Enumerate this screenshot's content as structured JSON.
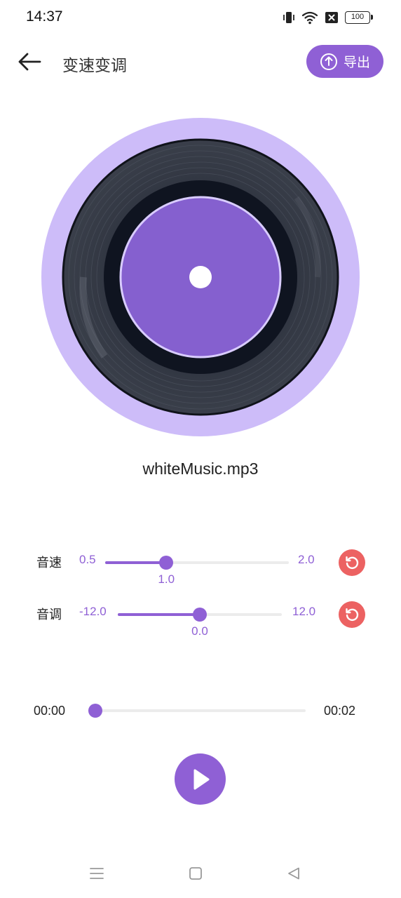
{
  "status_bar": {
    "time": "14:37",
    "battery": "100",
    "icons": [
      "vibrate-icon",
      "wifi-icon",
      "no-sim-icon",
      "battery-icon"
    ]
  },
  "app_bar": {
    "title": "变速变调",
    "export_label": "导出",
    "icons": [
      "back-arrow-icon",
      "upload-icon"
    ]
  },
  "player": {
    "file_name": "whiteMusic.mp3",
    "record_colors": {
      "halo": "#cdbcf9",
      "label": "#8560cf",
      "vinyl": "#2f3440"
    }
  },
  "sliders": [
    {
      "label": "音速",
      "min": "0.5",
      "max": "2.0",
      "value": "1.0",
      "fraction": 0.333
    },
    {
      "label": "音调",
      "min": "-12.0",
      "max": "12.0",
      "value": "0.0",
      "fraction": 0.5
    }
  ],
  "progress": {
    "current": "00:00",
    "total": "00:02",
    "fraction": 0.0
  },
  "colors": {
    "accent": "#8f60d5",
    "reset": "#ec6262",
    "track": "#ececec"
  },
  "nav_bar": {
    "icons": [
      "menu-icon",
      "home-square-icon",
      "back-triangle-icon"
    ]
  }
}
